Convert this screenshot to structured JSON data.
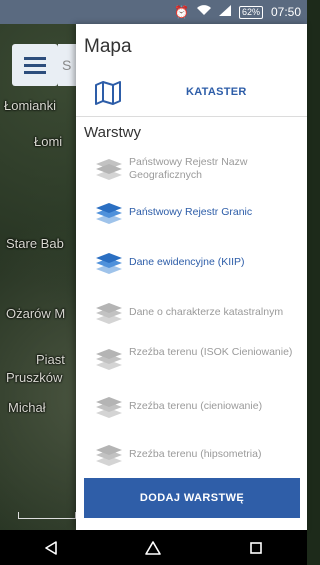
{
  "status": {
    "battery": "62%",
    "time": "07:50"
  },
  "map": {
    "search_peek": "S",
    "labels": [
      "Łomianki",
      "Łomi",
      "Stare Bab",
      "Ożarów M",
      "Piast",
      "Pruszków",
      "Michał"
    ]
  },
  "drawer": {
    "title": "Mapa",
    "kataster_label": "KATASTER",
    "section_title": "Warstwy",
    "layers": [
      {
        "label": "Państwowy Rejestr Nazw Geograficznych",
        "active": false
      },
      {
        "label": "Państwowy Rejestr Granic",
        "active": true
      },
      {
        "label": "Dane ewidencyjne (KIIP)",
        "active": true
      },
      {
        "label": "Dane o charakterze katastralnym",
        "active": false
      },
      {
        "label": "Rzeźba terenu (ISOK Cieniowanie)",
        "active": false
      },
      {
        "label": "Rzeźba terenu (cieniowanie)",
        "active": false
      },
      {
        "label": "Rzeźba terenu (hipsometria)",
        "active": false
      }
    ],
    "add_button": "DODAJ WARSTWĘ"
  },
  "colors": {
    "accent": "#2f5ea8",
    "inactive": "#9a9a9a"
  },
  "icons": {
    "menu": "hamburger-icon",
    "kataster": "map-icon",
    "layer": "layers-icon",
    "back": "back-triangle-icon",
    "home": "home-circle-icon",
    "recents": "recents-square-icon"
  }
}
